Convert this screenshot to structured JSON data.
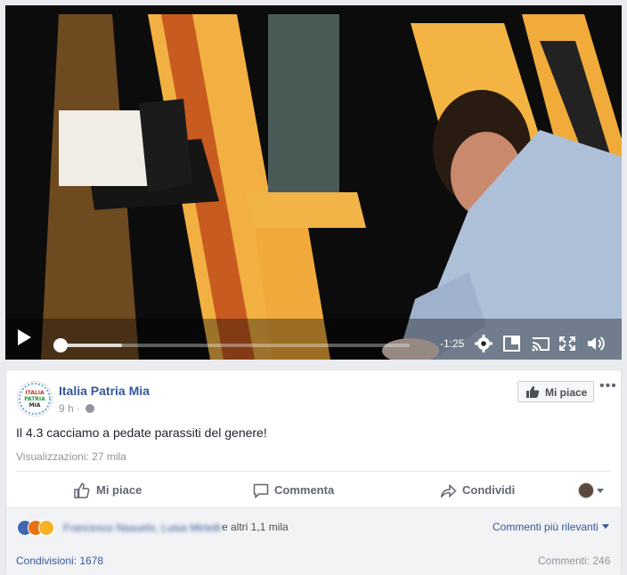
{
  "video": {
    "remaining_time": "-1:25",
    "progress": 0.0,
    "buffered": 0.18,
    "icons": [
      "play-icon",
      "settings-gear-icon",
      "fullscreen-pip-icon",
      "cast-icon",
      "expand-icon",
      "volume-icon"
    ]
  },
  "post": {
    "page_name": "Italia Patria Mia",
    "avatar_text": [
      "ITALIA",
      "PATRIA",
      "MIA"
    ],
    "time": "9 h",
    "separator": "·",
    "like_page_label": "Mi piace",
    "text": "Il 4.3 cacciamo a pedate parassiti del genere!",
    "views": "Visualizzazioni: 27 mila",
    "actions": {
      "like": "Mi piace",
      "comment": "Commenta",
      "share": "Condividi"
    },
    "reactions": {
      "names_blurred": "Francesco Nasuelo, Luisa Mirtelli",
      "others": "e altri 1,1 mila",
      "sort": "Commenti più rilevanti"
    },
    "shares": "Condivisioni: 1678",
    "comments": "Commenti: 246"
  },
  "colors": {
    "link": "#365899",
    "like_blue": "#4267b2",
    "angry": "#e9710f",
    "wow": "#f7b125"
  }
}
